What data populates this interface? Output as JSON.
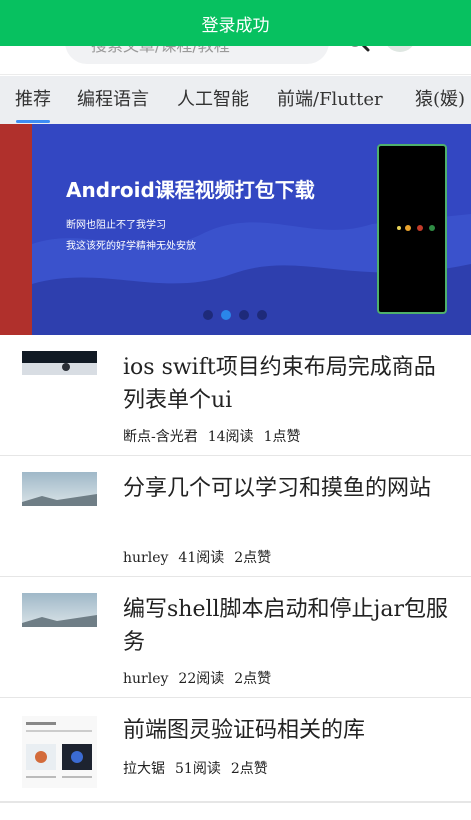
{
  "toast": {
    "message": "登录成功"
  },
  "search": {
    "placeholder": "搜索文章/课程/教程"
  },
  "tabs": [
    {
      "label": "推荐",
      "active": true
    },
    {
      "label": "编程语言",
      "active": false
    },
    {
      "label": "人工智能",
      "active": false
    },
    {
      "label": "前端/Flutter",
      "active": false
    },
    {
      "label": "猿(媛)",
      "active": false
    }
  ],
  "banner": {
    "title": "Android课程视频打包下载",
    "subtitle_1": "断网也阻止不了我学习",
    "subtitle_2": "我这该死的好学精神无处安放",
    "dots_count": 4,
    "active_dot": 1
  },
  "articles": [
    {
      "title": "ios swift项目约束布局完成商品列表单个ui",
      "author": "断点-含光君",
      "reads": "14阅读",
      "likes": "1点赞",
      "thumb": "dark-photo"
    },
    {
      "title": "分享几个可以学习和摸鱼的网站",
      "author": "hurley",
      "reads": "41阅读",
      "likes": "2点赞",
      "thumb": "sky-photo"
    },
    {
      "title": "编写shell脚本启动和停止jar包服务",
      "author": "hurley",
      "reads": "22阅读",
      "likes": "2点赞",
      "thumb": "sky-photo"
    },
    {
      "title": "前端图灵验证码相关的库",
      "author": "拉大锯",
      "reads": "51阅读",
      "likes": "2点赞",
      "thumb": "screenshot"
    }
  ],
  "colors": {
    "toast": "#07c160",
    "tab_indicator": "#3d8df5",
    "banner_bg": "#3347c2",
    "banner_left": "#b0302c"
  }
}
